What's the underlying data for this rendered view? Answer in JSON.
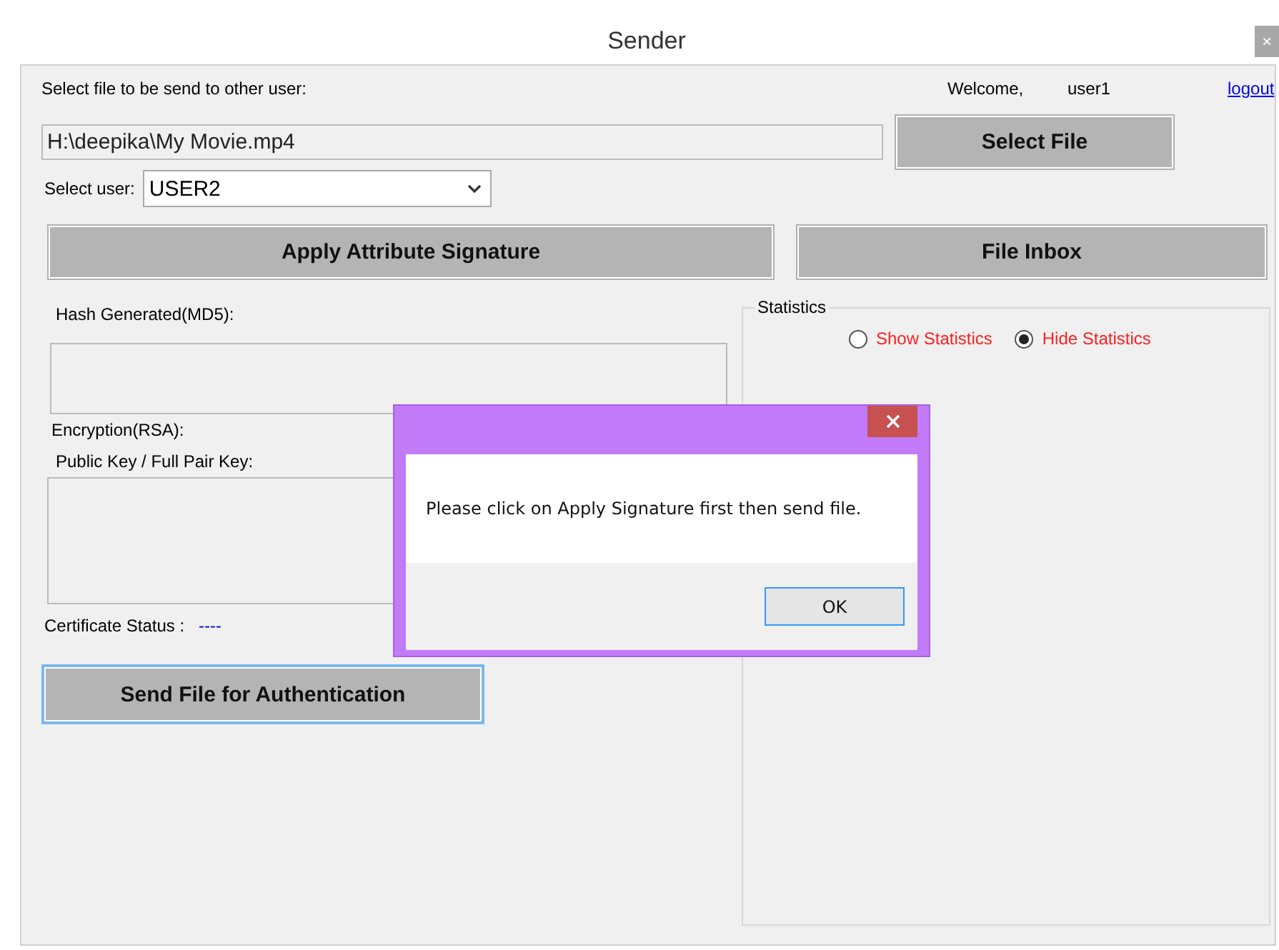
{
  "window": {
    "title": "Sender",
    "close": "×"
  },
  "file_label": "Select file to be send to other user:",
  "welcome": "Welcome,",
  "user": "user1",
  "logout": "logout",
  "file_path": "H:\\deepika\\My Movie.mp4",
  "select_file_button": "Select File",
  "select_user_label": "Select user:",
  "selected_user": "USER2",
  "apply_button": "Apply Attribute Signature",
  "inbox_button": "File Inbox",
  "hash_label": "Hash Generated(MD5):",
  "encryption_label": "Encryption(RSA):",
  "key_label": "Public Key / Full Pair Key:",
  "certificate_label": "Certificate Status :",
  "certificate_value": "----",
  "send_button": {
    "label": "Send File for Authentication",
    "focused": true
  },
  "statistics": {
    "title": "Statistics",
    "options": [
      {
        "label": "Show Statistics",
        "selected": false
      },
      {
        "label": "Hide Statistics",
        "selected": true
      }
    ]
  },
  "dialog": {
    "message": "Please click on Apply Signature first then send file.",
    "button": "OK"
  }
}
